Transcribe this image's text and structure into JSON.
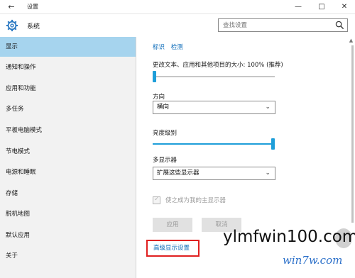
{
  "window": {
    "title": "设置"
  },
  "header": {
    "section_title": "系统",
    "search_placeholder": "查找设置"
  },
  "sidebar": {
    "items": [
      {
        "label": "显示",
        "active": true
      },
      {
        "label": "通知和操作"
      },
      {
        "label": "应用和功能"
      },
      {
        "label": "多任务"
      },
      {
        "label": "平板电脑模式"
      },
      {
        "label": "节电模式"
      },
      {
        "label": "电源和睡眠"
      },
      {
        "label": "存储"
      },
      {
        "label": "脱机地图"
      },
      {
        "label": "默认应用"
      },
      {
        "label": "关于"
      }
    ]
  },
  "content": {
    "link_identify": "标识",
    "link_detect": "检测",
    "scale_label": "更改文本、应用和其他项目的大小: 100% (推荐)",
    "scale_value_percent": 100,
    "orientation_label": "方向",
    "orientation_value": "横向",
    "brightness_label": "亮度级别",
    "brightness_value_percent": 100,
    "multi_display_label": "多显示器",
    "multi_display_value": "扩展这些显示器",
    "primary_checkbox_label": "使之成为我的主显示器",
    "primary_checkbox_checked": true,
    "apply_label": "应用",
    "cancel_label": "取消",
    "advanced_link": "高级显示设置"
  },
  "watermark": {
    "main": "ylmfwin100.com",
    "sub": "win7w.com"
  },
  "colors": {
    "accent": "#1e9ed9",
    "active_nav": "#a6d4ee",
    "link": "#0a6ab8",
    "highlight_box": "#e02020"
  }
}
